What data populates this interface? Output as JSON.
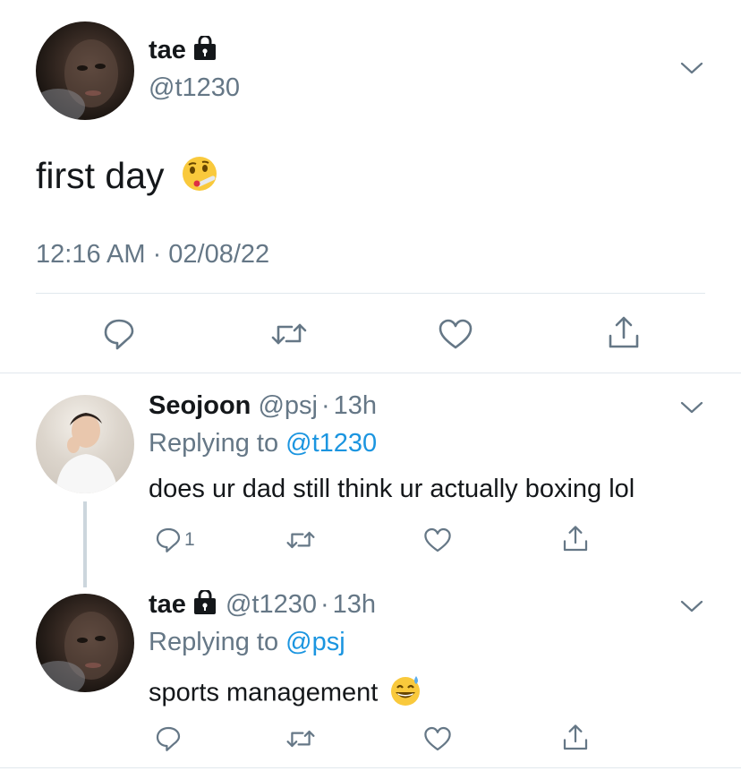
{
  "main_tweet": {
    "display_name": "tae",
    "handle": "@t1230",
    "text": "first day",
    "emoji": "face-with-thermometer",
    "timestamp": "12:16 AM · 02/08/22",
    "avatar": "dark-selfie-avatar",
    "protected_icon": "lock-icon"
  },
  "replies": [
    {
      "display_name": "Seojoon",
      "handle": "@psj",
      "sep": "·",
      "time": "13h",
      "replying_prefix": "Replying to",
      "replying_to": "@t1230",
      "text": "does ur dad still think ur actually boxing lol",
      "reply_count": "1",
      "avatar": "light-portrait-avatar"
    },
    {
      "display_name": "tae",
      "handle": "@t1230",
      "sep": "·",
      "time": "13h",
      "replying_prefix": "Replying to",
      "replying_to": "@psj",
      "text": "sports management",
      "emoji": "grinning-face-with-sweat",
      "avatar": "dark-selfie-avatar",
      "protected_icon": "lock-icon"
    }
  ],
  "colors": {
    "text": "#14171a",
    "secondary": "#657786",
    "link": "#1b95e0",
    "divider": "#e1e8ed",
    "icon": "#657786"
  }
}
